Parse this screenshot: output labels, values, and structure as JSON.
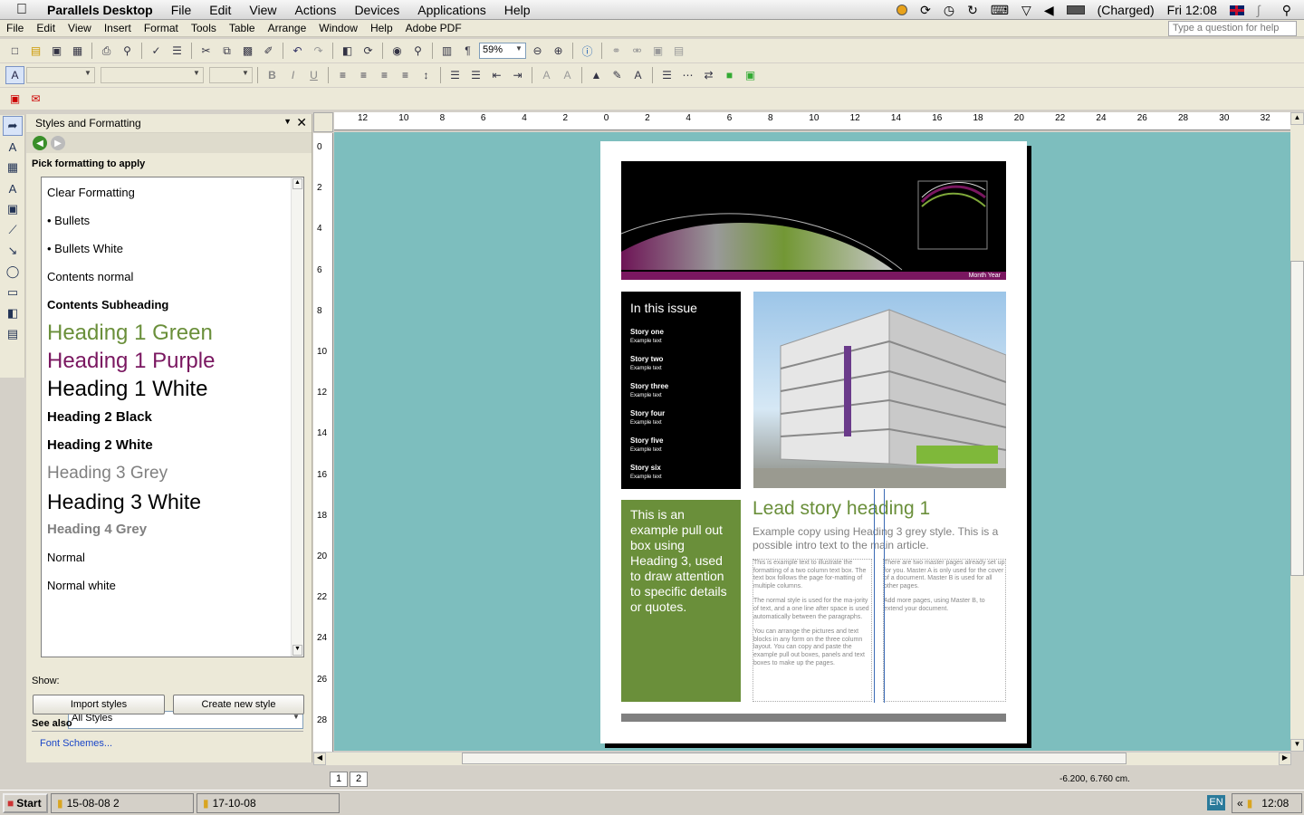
{
  "macbar": {
    "app": "Parallels Desktop",
    "menus": [
      "File",
      "Edit",
      "View",
      "Actions",
      "Devices",
      "Applications",
      "Help"
    ],
    "battery": "(Charged)",
    "clock": "Fri 12:08"
  },
  "word_menu": [
    "File",
    "Edit",
    "View",
    "Insert",
    "Format",
    "Tools",
    "Table",
    "Arrange",
    "Window",
    "Help",
    "Adobe PDF"
  ],
  "help_placeholder": "Type a question for help",
  "toolbar": {
    "zoom": "59%"
  },
  "pane": {
    "title": "Styles and Formatting",
    "pick_label": "Pick formatting to apply",
    "styles": [
      {
        "name": "Clear Formatting"
      },
      {
        "name": "• Bullets"
      },
      {
        "name": "• Bullets White"
      },
      {
        "name": "Contents normal"
      },
      {
        "name": "Contents Subheading"
      },
      {
        "name": "Heading 1 Green",
        "color": "#6a8f3a"
      },
      {
        "name": "Heading 1 Purple",
        "color": "#7a1760"
      },
      {
        "name": "Heading 1 White"
      },
      {
        "name": "Heading 2 Black"
      },
      {
        "name": "Heading 2 White"
      },
      {
        "name": "Heading 3 Grey",
        "color": "#808080"
      },
      {
        "name": "Heading 3 White"
      },
      {
        "name": "Heading 4 Grey",
        "color": "#808080"
      },
      {
        "name": "Normal"
      },
      {
        "name": "Normal white"
      }
    ],
    "show_label": "Show:",
    "show_value": "All Styles",
    "import_btn": "Import styles",
    "create_btn": "Create new style",
    "see_also": "See also",
    "font_schemes": "Font Schemes..."
  },
  "ruler": {
    "h_ticks": [
      "12",
      "10",
      "8",
      "6",
      "4",
      "2",
      "0",
      "2",
      "4",
      "6",
      "8",
      "10",
      "12",
      "14",
      "16",
      "18",
      "20",
      "22",
      "24",
      "26",
      "28",
      "30",
      "32"
    ],
    "v_ticks": [
      "0",
      "2",
      "4",
      "6",
      "8",
      "10",
      "12",
      "14",
      "16",
      "18",
      "20",
      "22",
      "24",
      "26",
      "28"
    ]
  },
  "document": {
    "month_year": "Month Year",
    "issue_title": "In this issue",
    "stories": [
      {
        "title": "Story one",
        "sub": "Example text"
      },
      {
        "title": "Story two",
        "sub": "Example text"
      },
      {
        "title": "Story three",
        "sub": "Example text"
      },
      {
        "title": "Story four",
        "sub": "Example text"
      },
      {
        "title": "Story five",
        "sub": "Example text"
      },
      {
        "title": "Story six",
        "sub": "Example text"
      }
    ],
    "pullout": "This is an example pull out box using Heading 3, used to draw attention to specific details or quotes.",
    "lead_heading": "Lead story heading 1",
    "intro": "Example copy using Heading 3 grey style. This is a possible intro text to the main article.",
    "col1": [
      "This is example text to illustrate the formatting of a two column text box. The text box follows the page for-matting of multiple columns.",
      "The normal style is used for the ma-jority of text, and a one line after space is used automatically between the paragraphs.",
      "You can arrange the pictures and text blocks in any form on the three column layout. You can copy and paste the example pull out boxes, panels and text boxes to make up the pages."
    ],
    "col2": [
      "There are two master pages already set up for you. Master A is only used for the cover of a document. Master B is used for all other pages.",
      "Add more pages, using Master B, to extend your document."
    ]
  },
  "pages": [
    "1",
    "2"
  ],
  "coords": "-6.200, 6.760 cm.",
  "taskbar": {
    "start": "Start",
    "items": [
      "15-08-08 2",
      "17-10-08"
    ],
    "lang": "EN",
    "time": "12:08"
  }
}
